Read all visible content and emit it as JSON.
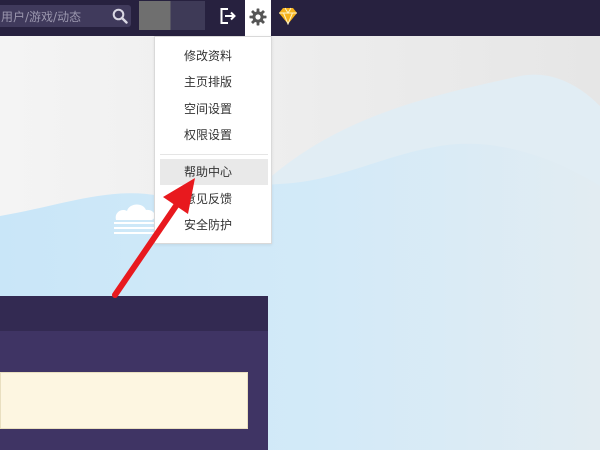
{
  "header": {
    "search": {
      "placeholder": "用户/游戏/动态",
      "icon": "search-icon"
    },
    "icons": [
      "logout-icon",
      "gear-icon",
      "diamond-icon"
    ]
  },
  "settings_menu": {
    "items": [
      {
        "label": "修改资料"
      },
      {
        "label": "主页排版"
      },
      {
        "label": "空间设置"
      },
      {
        "label": "权限设置"
      },
      {
        "label": "帮助中心",
        "highlighted": true
      },
      {
        "label": "意见反馈"
      },
      {
        "label": "安全防护"
      }
    ]
  },
  "annotation": {
    "type": "arrow",
    "color": "#e8191e",
    "points_to": "帮助中心"
  },
  "colors": {
    "topbar": "#27213f",
    "panel": "#3f3464",
    "sky": "#cfe8f7",
    "diamond": "#f6b21b"
  }
}
